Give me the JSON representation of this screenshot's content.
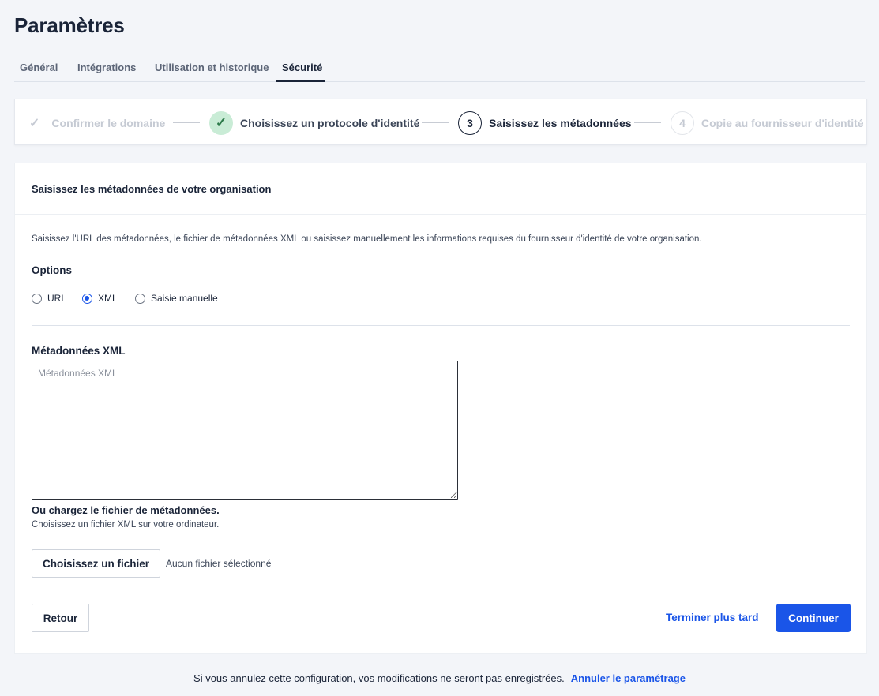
{
  "page": {
    "title": "Paramètres"
  },
  "tabs": [
    {
      "label": "Général"
    },
    {
      "label": "Intégrations"
    },
    {
      "label": "Utilisation et historique"
    },
    {
      "label": "Sécurité",
      "active": true
    }
  ],
  "stepper": {
    "steps": [
      {
        "label": "Confirmer le domaine",
        "state": "done",
        "icon": "check-icon"
      },
      {
        "label": "Choisissez un protocole d'identité",
        "state": "done",
        "icon": "check-icon"
      },
      {
        "number": "3",
        "label": "Saisissez les métadonnées",
        "state": "current"
      },
      {
        "number": "4",
        "label": "Copie au fournisseur d'identité",
        "state": "upcoming"
      }
    ]
  },
  "form": {
    "title": "Saisissez les métadonnées de votre organisation",
    "description": "Saisissez l'URL des métadonnées, le fichier de métadonnées XML ou saisissez manuellement les informations requises du fournisseur d'identité de votre organisation.",
    "options_label": "Options",
    "options": [
      {
        "label": "URL",
        "checked": false
      },
      {
        "label": "XML",
        "checked": true
      },
      {
        "label": "Saisie manuelle",
        "checked": false
      }
    ],
    "xml_label": "Métadonnées XML",
    "xml_placeholder": "Métadonnées XML",
    "xml_value": "",
    "upload_title": "Ou chargez le fichier de métadonnées.",
    "upload_subtitle": "Choisissez un fichier XML sur votre ordinateur.",
    "file_button": "Choisissez un fichier",
    "file_status": "Aucun fichier sélectionné",
    "back_button": "Retour",
    "later_link": "Terminer plus tard",
    "continue_button": "Continuer"
  },
  "footer": {
    "message": "Si vous annulez cette configuration, vos modifications ne seront pas enregistrées.",
    "cancel_link": "Annuler le paramétrage"
  },
  "colors": {
    "accent": "#1a55e8",
    "text": "#1a2438",
    "success_bg": "#c9ecd6"
  }
}
